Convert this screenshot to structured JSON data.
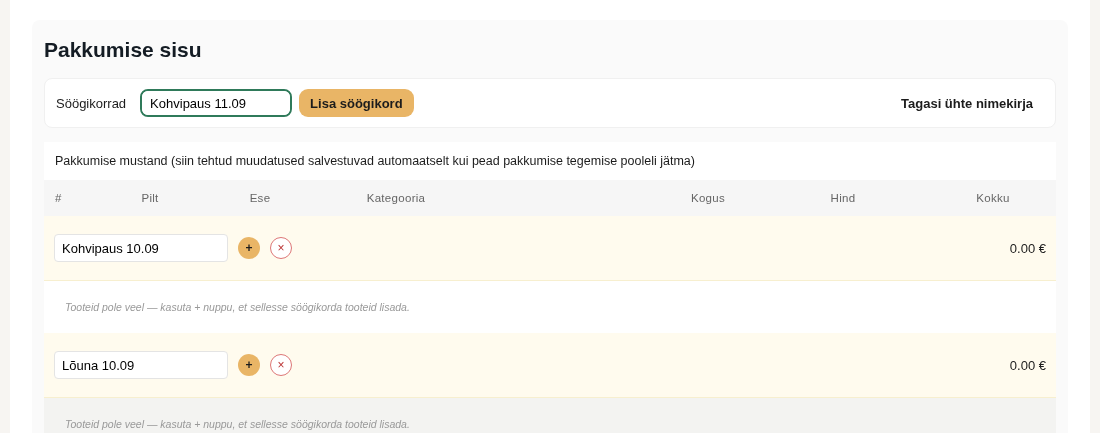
{
  "title": "Pakkumise sisu",
  "toolbar": {
    "label": "Söögikorrad",
    "input_value": "Kohvipaus 11.09",
    "add_button": "Lisa söögikord",
    "back_link": "Tagasi ühte nimekirja"
  },
  "draft": {
    "note": "Pakkumise mustand (siin tehtud muudatused salvestuvad automaatselt kui pead pakkumise tegemise pooleli jätma)",
    "columns": [
      "#",
      "Pilt",
      "Ese",
      "Kategooria",
      "Kogus",
      "Hind",
      "Kokku"
    ],
    "meals": [
      {
        "name": "Kohvipaus 10.09",
        "add_icon": "+",
        "remove_icon": "×",
        "total": "0.00 €",
        "empty_text": "Tooteid pole veel — kasuta + nuppu, et sellesse söögikorda tooteid lisada.",
        "highlighted": false
      },
      {
        "name": "Lõuna 10.09",
        "add_icon": "+",
        "remove_icon": "×",
        "total": "0.00 €",
        "empty_text": "Tooteid pole veel — kasuta + nuppu, et sellesse söögikorda tooteid lisada.",
        "highlighted": true
      }
    ]
  }
}
